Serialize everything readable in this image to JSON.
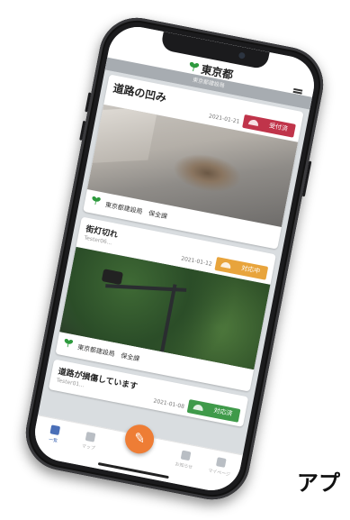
{
  "app": {
    "logo_text": "東京都",
    "subtitle": "東京都建設局",
    "brand_color": "#2e9a3e"
  },
  "icons": {
    "menu": "hamburger-menu-icon",
    "logo": "ginkgo-leaf-icon",
    "compose": "pencil-icon"
  },
  "reports": [
    {
      "title": "道路の凹み",
      "date": "2021-01-21",
      "status": "受付済",
      "status_color": "#c0344a",
      "department": "東京都建設局　保全課"
    },
    {
      "title": "街灯切れ",
      "user": "Tester06...",
      "date": "2021-01-12",
      "status": "対応中",
      "status_color": "#e8a43c",
      "department": "東京都建設局　保全課"
    },
    {
      "title": "道路が損傷しています",
      "user": "Tester01...",
      "date": "2021-01-08",
      "status": "対応済",
      "status_color": "#3f9a4a"
    }
  ],
  "tabbar": {
    "tabs": [
      {
        "label": "一覧",
        "icon": "list-icon"
      },
      {
        "label": "マップ",
        "icon": "map-icon"
      },
      {
        "label": "お知らせ",
        "icon": "bell-icon"
      },
      {
        "label": "マイページ",
        "icon": "user-icon"
      }
    ]
  },
  "caption": "アプ"
}
